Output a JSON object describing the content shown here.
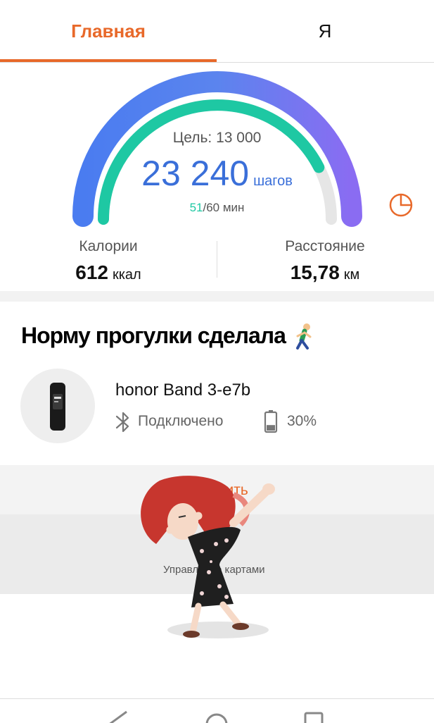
{
  "tabs": [
    {
      "label": "Главная",
      "active": true
    },
    {
      "label": "Я",
      "active": false
    }
  ],
  "steps": {
    "goal_label": "Цель: 13 000",
    "value": "23 240",
    "unit": "шагов",
    "active_minutes_done": "51",
    "active_minutes_rest": "/60 мин",
    "ring_progress_fraction": 1.0,
    "inner_ring_progress_fraction": 0.85
  },
  "stats": {
    "calories": {
      "label": "Калории",
      "value": "612",
      "unit": "ккал"
    },
    "distance": {
      "label": "Расстояние",
      "value": "15,78",
      "unit": "км"
    }
  },
  "sticker_text": "Норму прогулки сделала",
  "device": {
    "name": "honor Band 3-e7b",
    "bluetooth_status": "Подключено",
    "battery": "30%",
    "battery_level_fraction": 0.3
  },
  "add_label": "Добавить",
  "manage_cards_label": "Управление картами",
  "colors": {
    "accent": "#e8692a",
    "steps_blue": "#3a6fd9",
    "ring_teal": "#1ec8a3"
  },
  "icons": [
    "pie-chart-icon",
    "bluetooth-icon",
    "battery-icon",
    "walking-person-icon",
    "manage-cards-icon",
    "back-icon",
    "home-icon",
    "recents-icon"
  ]
}
